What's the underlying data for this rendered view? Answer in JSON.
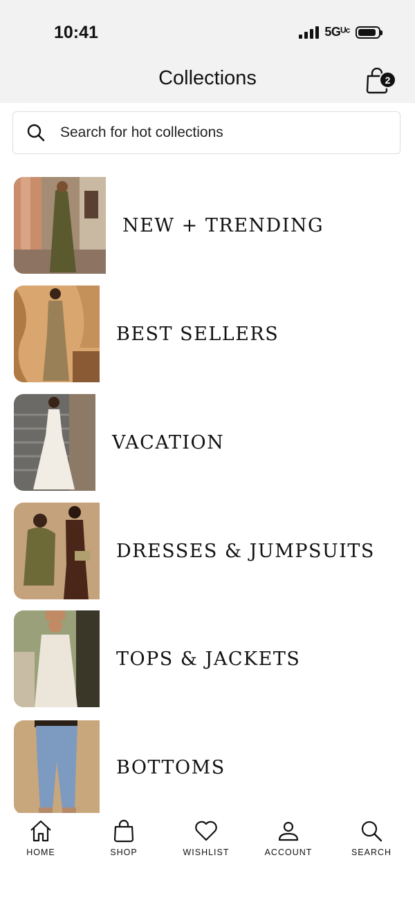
{
  "status_bar": {
    "time": "10:41",
    "network": "5Gᵁᶜ",
    "battery_level": 0.9
  },
  "header": {
    "title": "Collections",
    "cart_count": "2"
  },
  "search": {
    "placeholder": "Search for hot collections",
    "value": ""
  },
  "collections": [
    {
      "label": "NEW + TRENDING"
    },
    {
      "label": "BEST SELLERS"
    },
    {
      "label": "VACATION"
    },
    {
      "label": "DRESSES & JUMPSUITS"
    },
    {
      "label": "TOPS & JACKETS"
    },
    {
      "label": "BOTTOMS"
    }
  ],
  "tabbar": {
    "items": [
      {
        "label": "HOME",
        "icon": "home-icon"
      },
      {
        "label": "SHOP",
        "icon": "bag-icon"
      },
      {
        "label": "WISHLIST",
        "icon": "heart-icon"
      },
      {
        "label": "ACCOUNT",
        "icon": "person-icon"
      },
      {
        "label": "SEARCH",
        "icon": "search-icon"
      }
    ]
  }
}
